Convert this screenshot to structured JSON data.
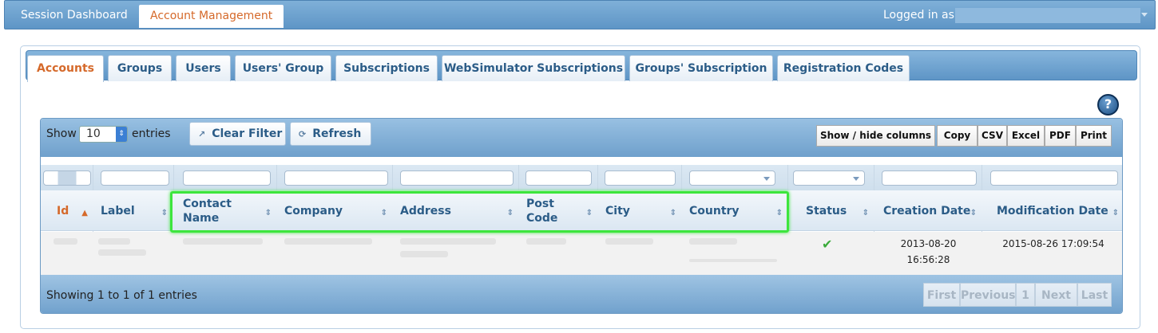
{
  "topbar": {
    "session_dashboard": "Session Dashboard",
    "account_management": "Account Management",
    "logged_in_as": "Logged in as"
  },
  "tabs": [
    {
      "label": "Accounts",
      "active": true
    },
    {
      "label": "Groups"
    },
    {
      "label": "Users"
    },
    {
      "label": "Users' Group"
    },
    {
      "label": "Subscriptions"
    },
    {
      "label": "WebSimulator Subscriptions"
    },
    {
      "label": "Groups' Subscription"
    },
    {
      "label": "Registration Codes"
    }
  ],
  "help": "?",
  "toolbar": {
    "show": "Show",
    "entries_value": "10",
    "entries": "entries",
    "clear_filter": "Clear Filter",
    "refresh": "Refresh",
    "show_hide_columns": "Show / hide columns",
    "copy": "Copy",
    "csv": "CSV",
    "excel": "Excel",
    "pdf": "PDF",
    "print": "Print"
  },
  "columns": [
    "Id",
    "Label",
    "Contact Name",
    "Company",
    "Address",
    "Post Code",
    "City",
    "Country",
    "Status",
    "Creation Date",
    "Modification Date"
  ],
  "row": {
    "creation_date_1": "2013-08-20",
    "creation_date_2": "16:56:28",
    "modification_date": "2015-08-26 17:09:54"
  },
  "footer": {
    "showing": "Showing 1 to 1 of 1 entries",
    "first": "First",
    "previous": "Previous",
    "page": "1",
    "next": "Next",
    "last": "Last"
  },
  "colors": {
    "accent": "#d5692a",
    "link": "#2b5c87",
    "highlight": "#3de53d"
  }
}
